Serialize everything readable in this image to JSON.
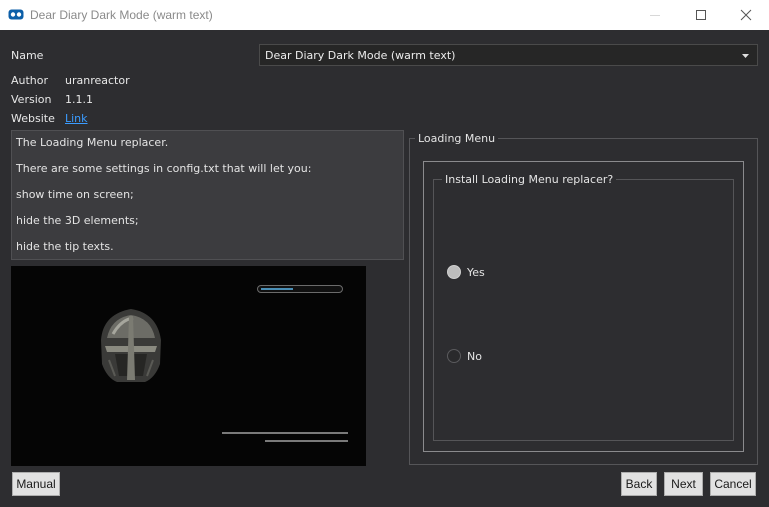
{
  "window": {
    "title": "Dear Diary Dark Mode (warm text)",
    "icon": "installer-app-icon"
  },
  "fields": {
    "name_label": "Name",
    "name_value": "Dear Diary Dark Mode (warm text)",
    "author_label": "Author",
    "author_value": "uranreactor",
    "version_label": "Version",
    "version_value": "1.1.1",
    "website_label": "Website",
    "website_link": "Link"
  },
  "description": [
    "The Loading Menu replacer.",
    "There are some settings in config.txt that will let you:",
    "show time on screen;",
    "hide the 3D elements;",
    "hide the tip texts."
  ],
  "preview": {
    "subject": "helmet-preview-image",
    "loading_bar_progress": 0.4
  },
  "options": {
    "group_title": "Loading Menu",
    "question": "Install Loading Menu replacer?",
    "choices": [
      {
        "label": "Yes",
        "selected": true
      },
      {
        "label": "No",
        "selected": false
      }
    ]
  },
  "buttons": {
    "manual": "Manual",
    "back": "Back",
    "next": "Next",
    "cancel": "Cancel"
  },
  "colors": {
    "background": "#2d2d30",
    "link": "#3b9cff",
    "preview_bar": "#4a8fb6"
  }
}
